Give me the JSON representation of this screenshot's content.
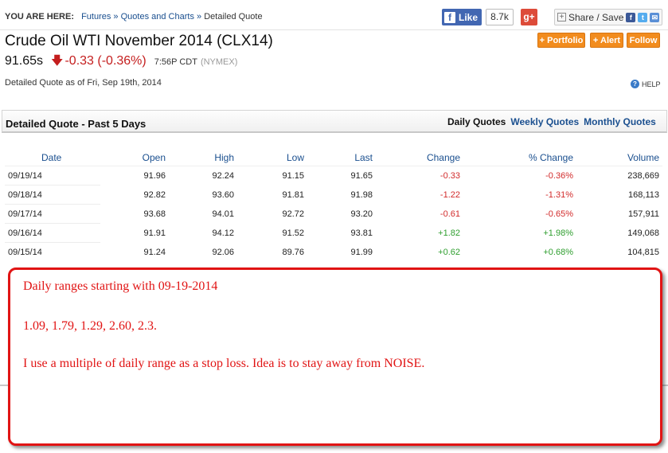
{
  "breadcrumb": {
    "label": "YOU ARE HERE:",
    "items": [
      "Futures",
      "Quotes and Charts"
    ],
    "separator": "»",
    "current": "Detailed Quote"
  },
  "social": {
    "like_label": "Like",
    "like_count": "8.7k",
    "gplus_label": "g+",
    "share_label": "Share / Save"
  },
  "quote": {
    "title": "Crude Oil WTI November 2014 (CLX14)",
    "price": "91.65s",
    "change": "-0.33 (-0.36%)",
    "time": "7:56P CDT",
    "exchange": "(NYMEX)",
    "as_of": "Detailed Quote as of Fri, Sep 19th, 2014",
    "help_label": "HELP"
  },
  "actions": {
    "portfolio": "+ Portfolio",
    "alert": "+ Alert",
    "follow": "Follow"
  },
  "section": {
    "title": "Detailed Quote - Past 5 Days",
    "tabs": [
      "Daily Quotes",
      "Weekly Quotes",
      "Monthly Quotes"
    ]
  },
  "table": {
    "columns": [
      "Date",
      "Open",
      "High",
      "Low",
      "Last",
      "Change",
      "% Change",
      "Volume"
    ],
    "rows": [
      {
        "date": "09/19/14",
        "open": "91.96",
        "high": "92.24",
        "low": "91.15",
        "last": "91.65",
        "change": "-0.33",
        "pct": "-0.36%",
        "volume": "238,669",
        "dir": "neg"
      },
      {
        "date": "09/18/14",
        "open": "92.82",
        "high": "93.60",
        "low": "91.81",
        "last": "91.98",
        "change": "-1.22",
        "pct": "-1.31%",
        "volume": "168,113",
        "dir": "neg"
      },
      {
        "date": "09/17/14",
        "open": "93.68",
        "high": "94.01",
        "low": "92.72",
        "last": "93.20",
        "change": "-0.61",
        "pct": "-0.65%",
        "volume": "157,911",
        "dir": "neg"
      },
      {
        "date": "09/16/14",
        "open": "91.91",
        "high": "94.12",
        "low": "91.52",
        "last": "93.81",
        "change": "+1.82",
        "pct": "+1.98%",
        "volume": "149,068",
        "dir": "pos"
      },
      {
        "date": "09/15/14",
        "open": "91.24",
        "high": "92.06",
        "low": "89.76",
        "last": "91.99",
        "change": "+0.62",
        "pct": "+0.68%",
        "volume": "104,815",
        "dir": "pos"
      }
    ]
  },
  "annotation": {
    "line1": "Daily ranges starting with 09-19-2014",
    "line2": "1.09,  1.79, 1.29,  2.60,  2.3.",
    "line3": "I use a multiple of daily range as a stop loss. Idea is to stay away from NOISE."
  },
  "colors": {
    "negative": "#d22b2b",
    "positive": "#2e9e2e",
    "link": "#1a4f8f",
    "accent_button": "#f28c1e",
    "annotation": "#e11414"
  }
}
